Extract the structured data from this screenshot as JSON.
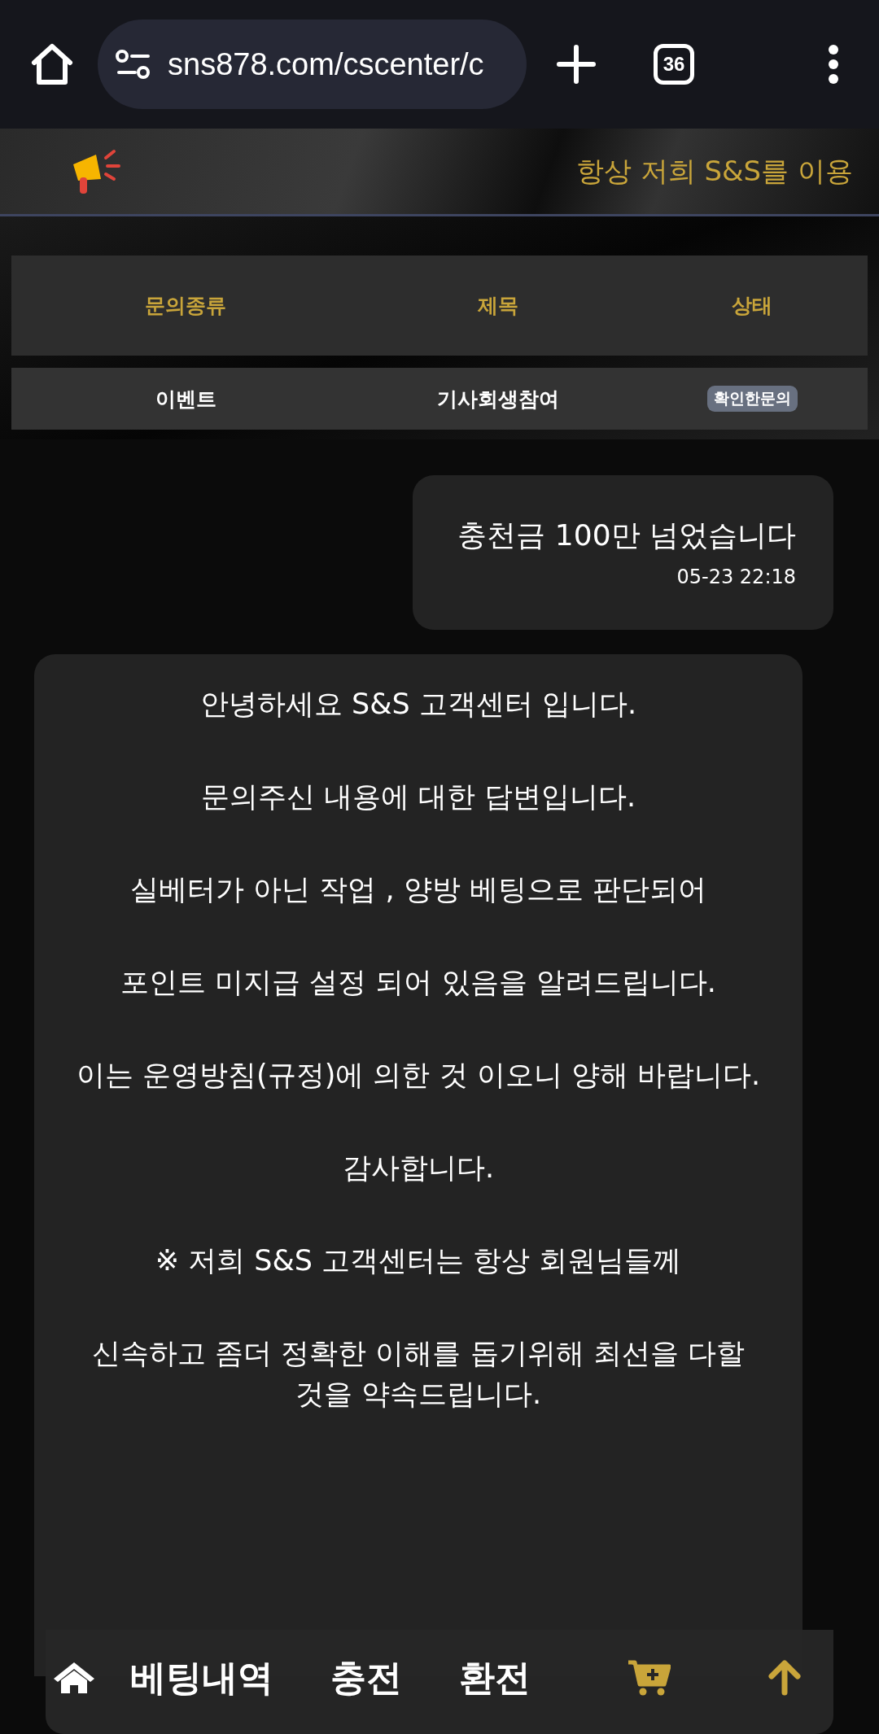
{
  "browser": {
    "url": "sns878.com/cscenter/c",
    "tab_count": "36"
  },
  "notice": {
    "text": "항상 저희 S&S를 이용"
  },
  "table": {
    "columns": [
      "문의종류",
      "제목",
      "상태"
    ],
    "rows": [
      {
        "type": "이벤트",
        "title": "기사회생참여",
        "status": "확인한문의"
      }
    ]
  },
  "messages": [
    {
      "kind": "question",
      "text": "충천금 100만 넘었습니다",
      "time": "05-23 22:18"
    },
    {
      "kind": "answer",
      "paragraphs": [
        "안녕하세요 S&S 고객센터 입니다.",
        "문의주신 내용에 대한 답변입니다.",
        "실베터가 아닌 작업 , 양방 베팅으로 판단되어",
        "포인트 미지급 설정 되어 있음을 알려드립니다.",
        "이는 운영방침(규정)에 의한 것 이오니 양해 바랍니다.",
        "감사합니다.",
        "※ 저희 S&S 고객센터는 항상 회원님들께",
        "신속하고 좀더 정확한 이해를 돕기위해 최선을 다할 것을 약속드립니다."
      ]
    }
  ],
  "bottom_nav": {
    "items": [
      "베팅내역",
      "충전",
      "환전"
    ]
  }
}
